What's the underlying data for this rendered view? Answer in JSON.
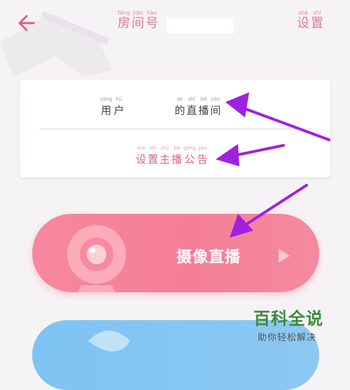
{
  "header": {
    "title_chars": [
      {
        "pinyin": "fáng",
        "char": "房"
      },
      {
        "pinyin": "jiān",
        "char": "间"
      },
      {
        "pinyin": "hào",
        "char": "号"
      }
    ],
    "settings_chars": [
      {
        "pinyin": "shè",
        "char": "设"
      },
      {
        "pinyin": "zhì",
        "char": "置"
      }
    ]
  },
  "card": {
    "user_left_chars": [
      {
        "pinyin": "yòng",
        "char": "用"
      },
      {
        "pinyin": "hù",
        "char": "户"
      }
    ],
    "user_right_chars": [
      {
        "pinyin": "de",
        "char": "的"
      },
      {
        "pinyin": "zhí",
        "char": "直"
      },
      {
        "pinyin": "bō",
        "char": "播"
      },
      {
        "pinyin": "jiān",
        "char": "间"
      }
    ],
    "notice_chars": [
      {
        "pinyin": "shè",
        "char": "设"
      },
      {
        "pinyin": "zhì",
        "char": "置"
      },
      {
        "pinyin": "zhǔ",
        "char": "主"
      },
      {
        "pinyin": "bō",
        "char": "播"
      },
      {
        "pinyin": "gōng",
        "char": "公"
      },
      {
        "pinyin": "gào",
        "char": "告"
      }
    ]
  },
  "live_button": {
    "label": "摄像直播"
  },
  "watermark": {
    "logo": "百科全说",
    "sub": "助你轻松解决"
  },
  "colors": {
    "accent": "#f57e97",
    "arrow": "#a020e0",
    "back": "#e0607e"
  },
  "icons": {
    "back": "back-arrow-icon",
    "camera": "camera-icon",
    "play": "play-triangle-icon"
  }
}
